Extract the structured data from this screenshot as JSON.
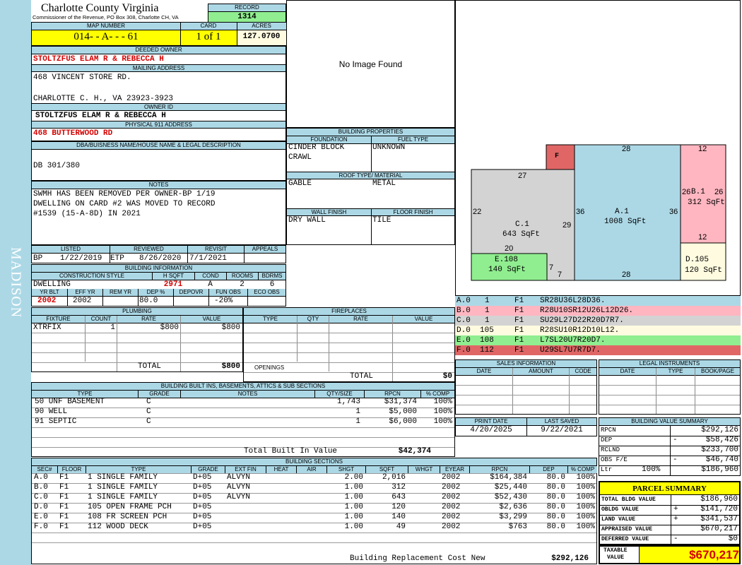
{
  "side_label": "MADISON",
  "header": {
    "county": "Charlotte County Virginia",
    "commissioner": "Commissioner of the Revenue, PO Box 308, Charlotte CH, VA",
    "record_label": "RECORD",
    "record": "1314",
    "map_label": "MAP NUMBER",
    "map": "014-  - A-   -   - 61",
    "card_label": "CARD",
    "card": "1 of 1",
    "acres_label": "ACRES",
    "acres": "127.0700"
  },
  "owner": {
    "deeded_label": "DEEDED OWNER",
    "deeded": "STOLTZFUS ELAM R & REBECCA H",
    "mailing_label": "MAILING ADDRESS",
    "mailing1": "468 VINCENT STORE RD.",
    "mailing2": "CHARLOTTE C. H., VA 23923-3923",
    "ownerid_label": "OWNER ID",
    "ownerid": "STOLTZFUS ELAM R & REBECCA H",
    "physical_label": "PHYSICAL 911 ADDRESS",
    "physical": "468 BUTTERWOOD RD",
    "dba_label": "DBA/BUISNESS NAME/HOUSE NAME & LEGAL DESCRIPTION",
    "dba": "DB 301/380",
    "notes_label": "NOTES",
    "notes": [
      "SWMH HAS BEEN REMOVED PER OWNER-BP 1/19",
      "DWELLING ON CARD #2 WAS MOVED TO RECORD",
      "#1539 (15-A-8D) IN 2021"
    ]
  },
  "image_text": "No Image Found",
  "building_props": {
    "title": "BUILDING PROPERTIES",
    "foundation_label": "FOUNDATION",
    "fuel_label": "FUEL TYPE",
    "foundation1": "CINDER BLOCK",
    "foundation2": "CRAWL",
    "fuel": "UNKNOWN",
    "roof_label": "ROOF TYPE/ MATERIAL",
    "roof_type": "GABLE",
    "roof_mat": "METAL",
    "wall_label": "WALL FINISH",
    "floor_label": "FLOOR FINISH",
    "wall": "DRY WALL",
    "floor": "TILE"
  },
  "dates": {
    "listed_label": "LISTED",
    "reviewed_label": "REVIEWED",
    "revisit_label": "REVISIT",
    "appeals_label": "APPEALS",
    "listed_code": "BP",
    "listed": "1/22/2019",
    "reviewed_code": "ETP",
    "reviewed": "8/26/2020",
    "revisit": "7/1/2021"
  },
  "building_info": {
    "title": "BUILDING INFORMATION",
    "h_const": "CONSTRUCTION STYLE",
    "h_hsqft": "H SQFT",
    "h_cond": "COND",
    "h_rooms": "ROOMS",
    "h_bdrms": "BDRMS",
    "style": "DWELLING",
    "hsqft": "2971",
    "cond": "A",
    "rooms": "2",
    "bdrms": "6",
    "h_yrblt": "YR BLT",
    "h_effyr": "EFF YR",
    "h_remyr": "REM YR",
    "h_dep": "DEP %",
    "h_depovr": "DEPOVR",
    "h_funobs": "FUN OBS",
    "h_ecoobs": "ECO OBS",
    "yrblt": "2002",
    "effyr": "2002",
    "dep": "80.0",
    "funobs": "-20%"
  },
  "plumbing": {
    "title": "PLUMBING",
    "h_fixture": "FIXTURE",
    "h_count": "COUNT",
    "h_rate": "RATE",
    "h_value": "VALUE",
    "fixture": "XTRFIX",
    "count": "1",
    "rate": "$800",
    "value": "$800",
    "total_label": "TOTAL",
    "total": "$800"
  },
  "fireplaces": {
    "title": "FIREPLACES",
    "h_type": "TYPE",
    "h_qty": "QTY",
    "h_rate": "RATE",
    "h_value": "VALUE",
    "openings": "OPENINGS",
    "total_label": "TOTAL",
    "total": "$0"
  },
  "sketch": {
    "F": "F",
    "A": "A.1",
    "A_area": "1008 SqFt",
    "B": "B.1",
    "B_area": "312 SqFt",
    "C": "C.1",
    "C_area": "643 SqFt",
    "D": "D.105",
    "D_area": "120 SqFt",
    "E": "E.108",
    "E_area": "140 SqFt",
    "dims": {
      "top28": "28",
      "top12": "12",
      "b26l": "26",
      "b26r": "26",
      "b12": "12",
      "c27": "27",
      "c22": "22",
      "a36l": "36",
      "a36r": "36",
      "c29": "29",
      "c20": "20",
      "e7a": "7",
      "e7b": "7",
      "bot28": "28"
    }
  },
  "segments": [
    {
      "id": "A.0",
      "n": "1",
      "fl": "F1",
      "code": "SR28U36L28D36.",
      "color": "#acd8e6"
    },
    {
      "id": "B.0",
      "n": "1",
      "fl": "F1",
      "code": "R28U10SR12U26L12D26.",
      "color": "#ffb6c1"
    },
    {
      "id": "C.0",
      "n": "1",
      "fl": "F1",
      "code": "SU29L27D22R20D7R7.",
      "color": "#d3d3d3"
    },
    {
      "id": "D.0",
      "n": "105",
      "fl": "F1",
      "code": "R28SU10R12D10L12.",
      "color": "#fffbe0"
    },
    {
      "id": "E.0",
      "n": "108",
      "fl": "F1",
      "code": "L7SL20U7R20D7.",
      "color": "#90ee90"
    },
    {
      "id": "F.0",
      "n": "112",
      "fl": "F1",
      "code": "U29SL7U7R7D7.",
      "color": "#e06666"
    }
  ],
  "sales": {
    "title": "SALES INFORMATION",
    "h_date": "DATE",
    "h_amount": "AMOUNT",
    "h_code": "CODE"
  },
  "legal": {
    "title": "LEGAL INSTRUMENTS",
    "h_date": "DATE",
    "h_type": "TYPE",
    "h_book": "BOOK/PAGE"
  },
  "builtins": {
    "title": "BUILDING BUILT INS, BASEMENTS, ATTICS & SUB SECTIONS",
    "h_type": "TYPE",
    "h_grade": "GRADE",
    "h_notes": "NOTES",
    "h_qty": "QTY/SIZE",
    "h_rpcn": "RPCN",
    "h_comp": "% COMP",
    "rows": [
      {
        "type": "50 UNF BASEMENT",
        "grade": "C",
        "qty": "1,743",
        "rpcn": "$31,374",
        "comp": "100%"
      },
      {
        "type": "90 WELL",
        "grade": "C",
        "qty": "1",
        "rpcn": "$5,000",
        "comp": "100%"
      },
      {
        "type": "91 SEPTIC",
        "grade": "C",
        "qty": "1",
        "rpcn": "$6,000",
        "comp": "100%"
      }
    ],
    "total_label": "Total Built In Value",
    "total": "$42,374"
  },
  "print": {
    "print_label": "PRINT DATE",
    "saved_label": "LAST SAVED",
    "print_date": "4/20/2025",
    "saved_date": "9/22/2021"
  },
  "value_summary": {
    "title": "BUILDING VALUE SUMMARY",
    "rows": [
      {
        "label": "RPCN",
        "pct": "",
        "sign": "",
        "value": "$292,126"
      },
      {
        "label": "DEP",
        "pct": "",
        "sign": "-",
        "value": "$58,426"
      },
      {
        "label": "RCLND",
        "pct": "",
        "sign": "",
        "value": "$233,700"
      },
      {
        "label": "OBS F/E",
        "pct": "",
        "sign": "-",
        "value": "$46,740"
      },
      {
        "label": "Ltr",
        "pct": "100%",
        "sign": "",
        "value": "$186,960"
      }
    ]
  },
  "parcel": {
    "title": "PARCEL SUMMARY",
    "rows": [
      {
        "label": "TOTAL BLDG VALUE",
        "sign": "",
        "value": "$186,960"
      },
      {
        "label": "OBLDG VALUE",
        "sign": "+",
        "value": "$141,720"
      },
      {
        "label": "LAND VALUE",
        "sign": "+",
        "value": "$341,537"
      },
      {
        "label": "APPRAISED VALUE",
        "sign": "",
        "value": "$670,217"
      },
      {
        "label": "DEFERRED VALUE",
        "sign": "-",
        "value": "$0"
      }
    ],
    "taxable_label1": "TAXABLE",
    "taxable_label2": "VALUE",
    "taxable": "$670,217"
  },
  "sections": {
    "title": "BUILDING SECTIONS",
    "headers": [
      "SEC#",
      "FLOOR",
      "TYPE",
      "GRADE",
      "EXT FIN",
      "HEAT",
      "AIR",
      "SHGT",
      "SQFT",
      "WHGT",
      "EYEAR",
      "RPCN",
      "DEP",
      "% COMP"
    ],
    "rows": [
      [
        "A.0",
        "F1",
        "1 SINGLE FAMILY",
        "D+05",
        "ALVYN",
        "",
        "",
        "2.00",
        "2,016",
        "",
        "2002",
        "$164,384",
        "80.0",
        "100%"
      ],
      [
        "B.0",
        "F1",
        "1 SINGLE FAMILY",
        "D+05",
        "ALVYN",
        "",
        "",
        "1.00",
        "312",
        "",
        "2002",
        "$25,440",
        "80.0",
        "100%"
      ],
      [
        "C.0",
        "F1",
        "1 SINGLE FAMILY",
        "D+05",
        "ALVYN",
        "",
        "",
        "1.00",
        "643",
        "",
        "2002",
        "$52,430",
        "80.0",
        "100%"
      ],
      [
        "D.0",
        "F1",
        "105 OPEN FRAME PCH",
        "D+05",
        "",
        "",
        "",
        "1.00",
        "120",
        "",
        "2002",
        "$2,636",
        "80.0",
        "100%"
      ],
      [
        "E.0",
        "F1",
        "108 FR SCREEN PCH",
        "D+05",
        "",
        "",
        "",
        "1.00",
        "140",
        "",
        "2002",
        "$3,299",
        "80.0",
        "100%"
      ],
      [
        "F.0",
        "F1",
        "112 WOOD DECK",
        "D+05",
        "",
        "",
        "",
        "1.00",
        "49",
        "",
        "2002",
        "$763",
        "80.0",
        "100%"
      ]
    ],
    "total_label": "Building Replacement Cost New",
    "total": "$292,126"
  }
}
